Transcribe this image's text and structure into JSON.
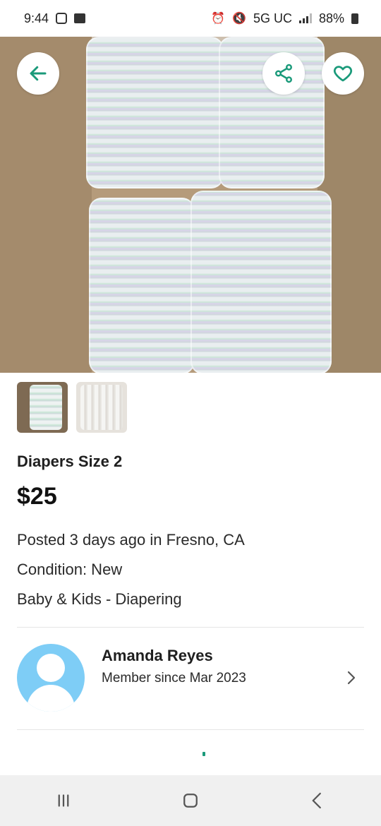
{
  "status_bar": {
    "time": "9:44",
    "network": "5G UC",
    "battery": "88%"
  },
  "header_actions": {
    "back_icon": "arrow-left-icon",
    "share_icon": "share-icon",
    "favorite_icon": "heart-icon",
    "accent": "#1a9a7a"
  },
  "listing": {
    "title": "Diapers Size 2",
    "price": "$25",
    "posted": "Posted 3 days ago in Fresno, CA",
    "condition": "Condition: New",
    "category": "Baby & Kids - Diapering",
    "photo_count": 2
  },
  "seller": {
    "name": "Amanda Reyes",
    "member_since": "Member since Mar 2023"
  }
}
